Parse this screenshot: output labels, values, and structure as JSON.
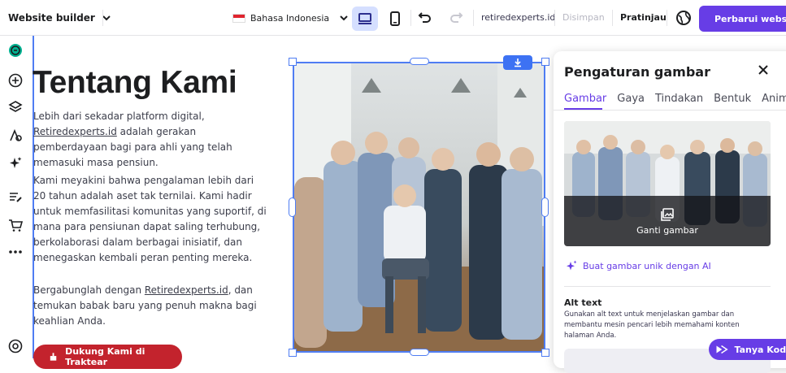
{
  "topbar": {
    "brand_label": "Website builder",
    "language": "Bahasa Indonesia",
    "domain": "retiredexperts.id",
    "saved_label": "Disimpan",
    "preview_label": "Pratinjau",
    "update_label": "Perbarui website"
  },
  "sidebar": {
    "icons": [
      "sections-icon",
      "add-element-icon",
      "layers-icon",
      "styles-icon",
      "ai-tools-icon",
      "blog-icon",
      "store-icon",
      "more-icon",
      "help-icon"
    ]
  },
  "page": {
    "title": "Tentang Kami",
    "para1_a": "Lebih dari sekadar platform digital,",
    "para1_link": "Retiredexperts.id",
    "para1_b": " adalah gerakan pemberdayaan bagi para ahli yang telah memasuki masa pensiun.",
    "para2": "Kami meyakini bahwa pengalaman lebih dari 20 tahun adalah aset tak ternilai. Kami hadir untuk memfasilitasi komunitas yang suportif, di mana para pensiunan dapat saling terhubung, berkolaborasi dalam berbagai inisiatif, dan menegaskan kembali peran penting mereka.",
    "para3_a": "Bergabunglah dengan ",
    "para3_link": "Retiredexperts.id",
    "para3_b": ", dan temukan babak baru yang penuh makna bagi keahlian Anda.",
    "cta_label": "Dukung Kami di Traktear"
  },
  "panel": {
    "title": "Pengaturan gambar",
    "tabs": [
      {
        "label": "Gambar",
        "active": true
      },
      {
        "label": "Gaya",
        "active": false
      },
      {
        "label": "Tindakan",
        "active": false
      },
      {
        "label": "Bentuk",
        "active": false
      },
      {
        "label": "Animasi",
        "active": false
      }
    ],
    "replace_label": "Ganti gambar",
    "ai_label": "Buat gambar unik dengan AI",
    "alt_title": "Alt text",
    "alt_desc": "Gunakan alt text untuk menjelaskan gambar dan membantu mesin pencari lebih memahami konten halaman Anda."
  },
  "ask_label": "Tanya Kodee",
  "colors": {
    "accent": "#673de6",
    "selection": "#4f7df3",
    "cta": "#c3232d"
  }
}
